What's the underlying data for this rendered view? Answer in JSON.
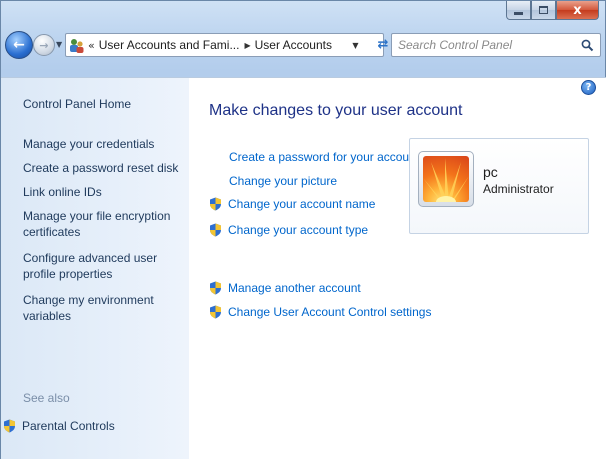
{
  "window": {
    "minimize_label": "",
    "maximize_label": "",
    "close_label": "x"
  },
  "nav": {
    "breadcrumb_overflow": "«",
    "breadcrumb": [
      "User Accounts and Fami...",
      "User Accounts"
    ],
    "search_placeholder": "Search Control Panel"
  },
  "sidebar": {
    "items": [
      {
        "label": "Control Panel Home"
      },
      {
        "label": "Manage your credentials"
      },
      {
        "label": "Create a password reset disk"
      },
      {
        "label": "Link online IDs"
      },
      {
        "label": "Manage your file encryption certificates"
      },
      {
        "label": "Configure advanced user profile properties"
      },
      {
        "label": "Change my environment variables"
      }
    ],
    "see_also_heading": "See also",
    "see_also_items": [
      {
        "label": "Parental Controls"
      }
    ]
  },
  "main": {
    "title": "Make changes to your user account",
    "tasks": [
      {
        "label": "Create a password for your account",
        "shield": false
      },
      {
        "label": "Change your picture",
        "shield": false
      },
      {
        "label": "Change your account name",
        "shield": true
      },
      {
        "label": "Change your account type",
        "shield": true
      }
    ],
    "other_tasks": [
      {
        "label": "Manage another account",
        "shield": true
      },
      {
        "label": "Change User Account Control settings",
        "shield": true
      }
    ],
    "account": {
      "name": "pc",
      "type": "Administrator"
    },
    "help_label": "?"
  },
  "colors": {
    "link": "#0066cc",
    "title": "#1e3287",
    "sidebar_link": "#1e395b",
    "muted": "#7a8ea8"
  }
}
